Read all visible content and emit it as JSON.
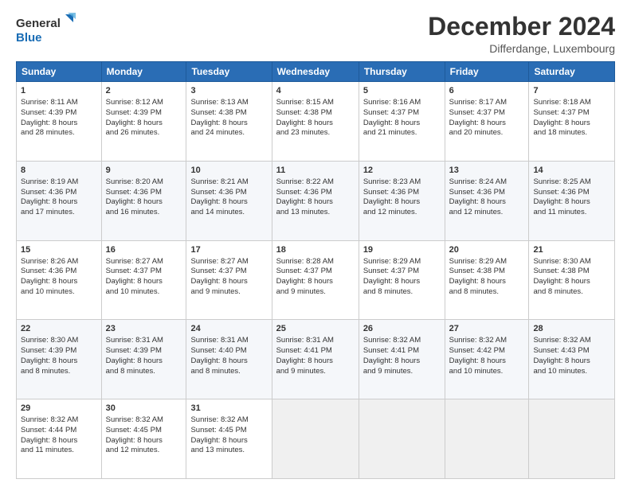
{
  "header": {
    "logo_general": "General",
    "logo_blue": "Blue",
    "title": "December 2024",
    "subtitle": "Differdange, Luxembourg"
  },
  "columns": [
    "Sunday",
    "Monday",
    "Tuesday",
    "Wednesday",
    "Thursday",
    "Friday",
    "Saturday"
  ],
  "weeks": [
    [
      {
        "day": "1",
        "sunrise": "8:11 AM",
        "sunset": "4:39 PM",
        "daylight": "8 hours and 28 minutes."
      },
      {
        "day": "2",
        "sunrise": "8:12 AM",
        "sunset": "4:39 PM",
        "daylight": "8 hours and 26 minutes."
      },
      {
        "day": "3",
        "sunrise": "8:13 AM",
        "sunset": "4:38 PM",
        "daylight": "8 hours and 24 minutes."
      },
      {
        "day": "4",
        "sunrise": "8:15 AM",
        "sunset": "4:38 PM",
        "daylight": "8 hours and 23 minutes."
      },
      {
        "day": "5",
        "sunrise": "8:16 AM",
        "sunset": "4:37 PM",
        "daylight": "8 hours and 21 minutes."
      },
      {
        "day": "6",
        "sunrise": "8:17 AM",
        "sunset": "4:37 PM",
        "daylight": "8 hours and 20 minutes."
      },
      {
        "day": "7",
        "sunrise": "8:18 AM",
        "sunset": "4:37 PM",
        "daylight": "8 hours and 18 minutes."
      }
    ],
    [
      {
        "day": "8",
        "sunrise": "8:19 AM",
        "sunset": "4:36 PM",
        "daylight": "8 hours and 17 minutes."
      },
      {
        "day": "9",
        "sunrise": "8:20 AM",
        "sunset": "4:36 PM",
        "daylight": "8 hours and 16 minutes."
      },
      {
        "day": "10",
        "sunrise": "8:21 AM",
        "sunset": "4:36 PM",
        "daylight": "8 hours and 14 minutes."
      },
      {
        "day": "11",
        "sunrise": "8:22 AM",
        "sunset": "4:36 PM",
        "daylight": "8 hours and 13 minutes."
      },
      {
        "day": "12",
        "sunrise": "8:23 AM",
        "sunset": "4:36 PM",
        "daylight": "8 hours and 12 minutes."
      },
      {
        "day": "13",
        "sunrise": "8:24 AM",
        "sunset": "4:36 PM",
        "daylight": "8 hours and 12 minutes."
      },
      {
        "day": "14",
        "sunrise": "8:25 AM",
        "sunset": "4:36 PM",
        "daylight": "8 hours and 11 minutes."
      }
    ],
    [
      {
        "day": "15",
        "sunrise": "8:26 AM",
        "sunset": "4:36 PM",
        "daylight": "8 hours and 10 minutes."
      },
      {
        "day": "16",
        "sunrise": "8:27 AM",
        "sunset": "4:37 PM",
        "daylight": "8 hours and 10 minutes."
      },
      {
        "day": "17",
        "sunrise": "8:27 AM",
        "sunset": "4:37 PM",
        "daylight": "8 hours and 9 minutes."
      },
      {
        "day": "18",
        "sunrise": "8:28 AM",
        "sunset": "4:37 PM",
        "daylight": "8 hours and 9 minutes."
      },
      {
        "day": "19",
        "sunrise": "8:29 AM",
        "sunset": "4:37 PM",
        "daylight": "8 hours and 8 minutes."
      },
      {
        "day": "20",
        "sunrise": "8:29 AM",
        "sunset": "4:38 PM",
        "daylight": "8 hours and 8 minutes."
      },
      {
        "day": "21",
        "sunrise": "8:30 AM",
        "sunset": "4:38 PM",
        "daylight": "8 hours and 8 minutes."
      }
    ],
    [
      {
        "day": "22",
        "sunrise": "8:30 AM",
        "sunset": "4:39 PM",
        "daylight": "8 hours and 8 minutes."
      },
      {
        "day": "23",
        "sunrise": "8:31 AM",
        "sunset": "4:39 PM",
        "daylight": "8 hours and 8 minutes."
      },
      {
        "day": "24",
        "sunrise": "8:31 AM",
        "sunset": "4:40 PM",
        "daylight": "8 hours and 8 minutes."
      },
      {
        "day": "25",
        "sunrise": "8:31 AM",
        "sunset": "4:41 PM",
        "daylight": "8 hours and 9 minutes."
      },
      {
        "day": "26",
        "sunrise": "8:32 AM",
        "sunset": "4:41 PM",
        "daylight": "8 hours and 9 minutes."
      },
      {
        "day": "27",
        "sunrise": "8:32 AM",
        "sunset": "4:42 PM",
        "daylight": "8 hours and 10 minutes."
      },
      {
        "day": "28",
        "sunrise": "8:32 AM",
        "sunset": "4:43 PM",
        "daylight": "8 hours and 10 minutes."
      }
    ],
    [
      {
        "day": "29",
        "sunrise": "8:32 AM",
        "sunset": "4:44 PM",
        "daylight": "8 hours and 11 minutes."
      },
      {
        "day": "30",
        "sunrise": "8:32 AM",
        "sunset": "4:45 PM",
        "daylight": "8 hours and 12 minutes."
      },
      {
        "day": "31",
        "sunrise": "8:32 AM",
        "sunset": "4:45 PM",
        "daylight": "8 hours and 13 minutes."
      },
      null,
      null,
      null,
      null
    ]
  ]
}
